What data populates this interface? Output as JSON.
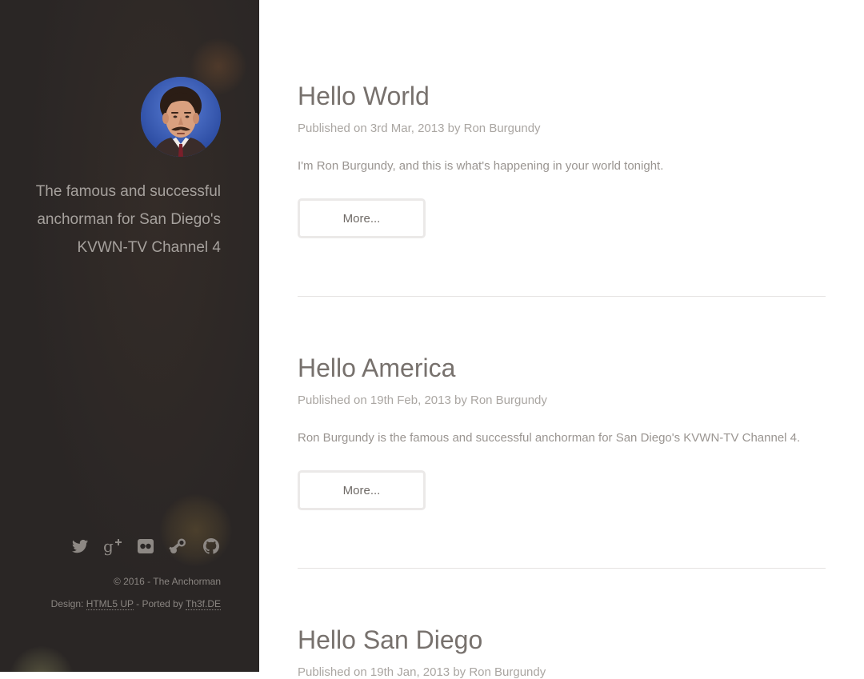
{
  "sidebar": {
    "bio": "The famous and successful anchorman for San Diego's KVWN-TV Channel 4",
    "social_icons": [
      "twitter-icon",
      "google-plus-icon",
      "flickr-icon",
      "steam-icon",
      "github-icon"
    ],
    "copyright": "© 2016 - The Anchorman",
    "credits": {
      "design_prefix": "Design: ",
      "design_link": "HTML5 UP",
      "ported_prefix": " - Ported by ",
      "ported_link": "Th3f.DE"
    }
  },
  "posts": [
    {
      "title": "Hello World",
      "meta": "Published on 3rd Mar, 2013 by Ron Burgundy",
      "excerpt": "I'm Ron Burgundy, and this is what's happening in your world tonight.",
      "more_label": "More..."
    },
    {
      "title": "Hello America",
      "meta": "Published on 19th Feb, 2013 by Ron Burgundy",
      "excerpt": "Ron Burgundy is the famous and successful anchorman for San Diego's KVWN-TV Channel 4.",
      "more_label": "More..."
    },
    {
      "title": "Hello San Diego",
      "meta": "Published on 19th Jan, 2013 by Ron Burgundy"
    }
  ],
  "colors": {
    "sidebar_bg": "#2a2625",
    "heading": "#77716d",
    "text": "#9a9591",
    "meta": "#aaa6a2"
  }
}
